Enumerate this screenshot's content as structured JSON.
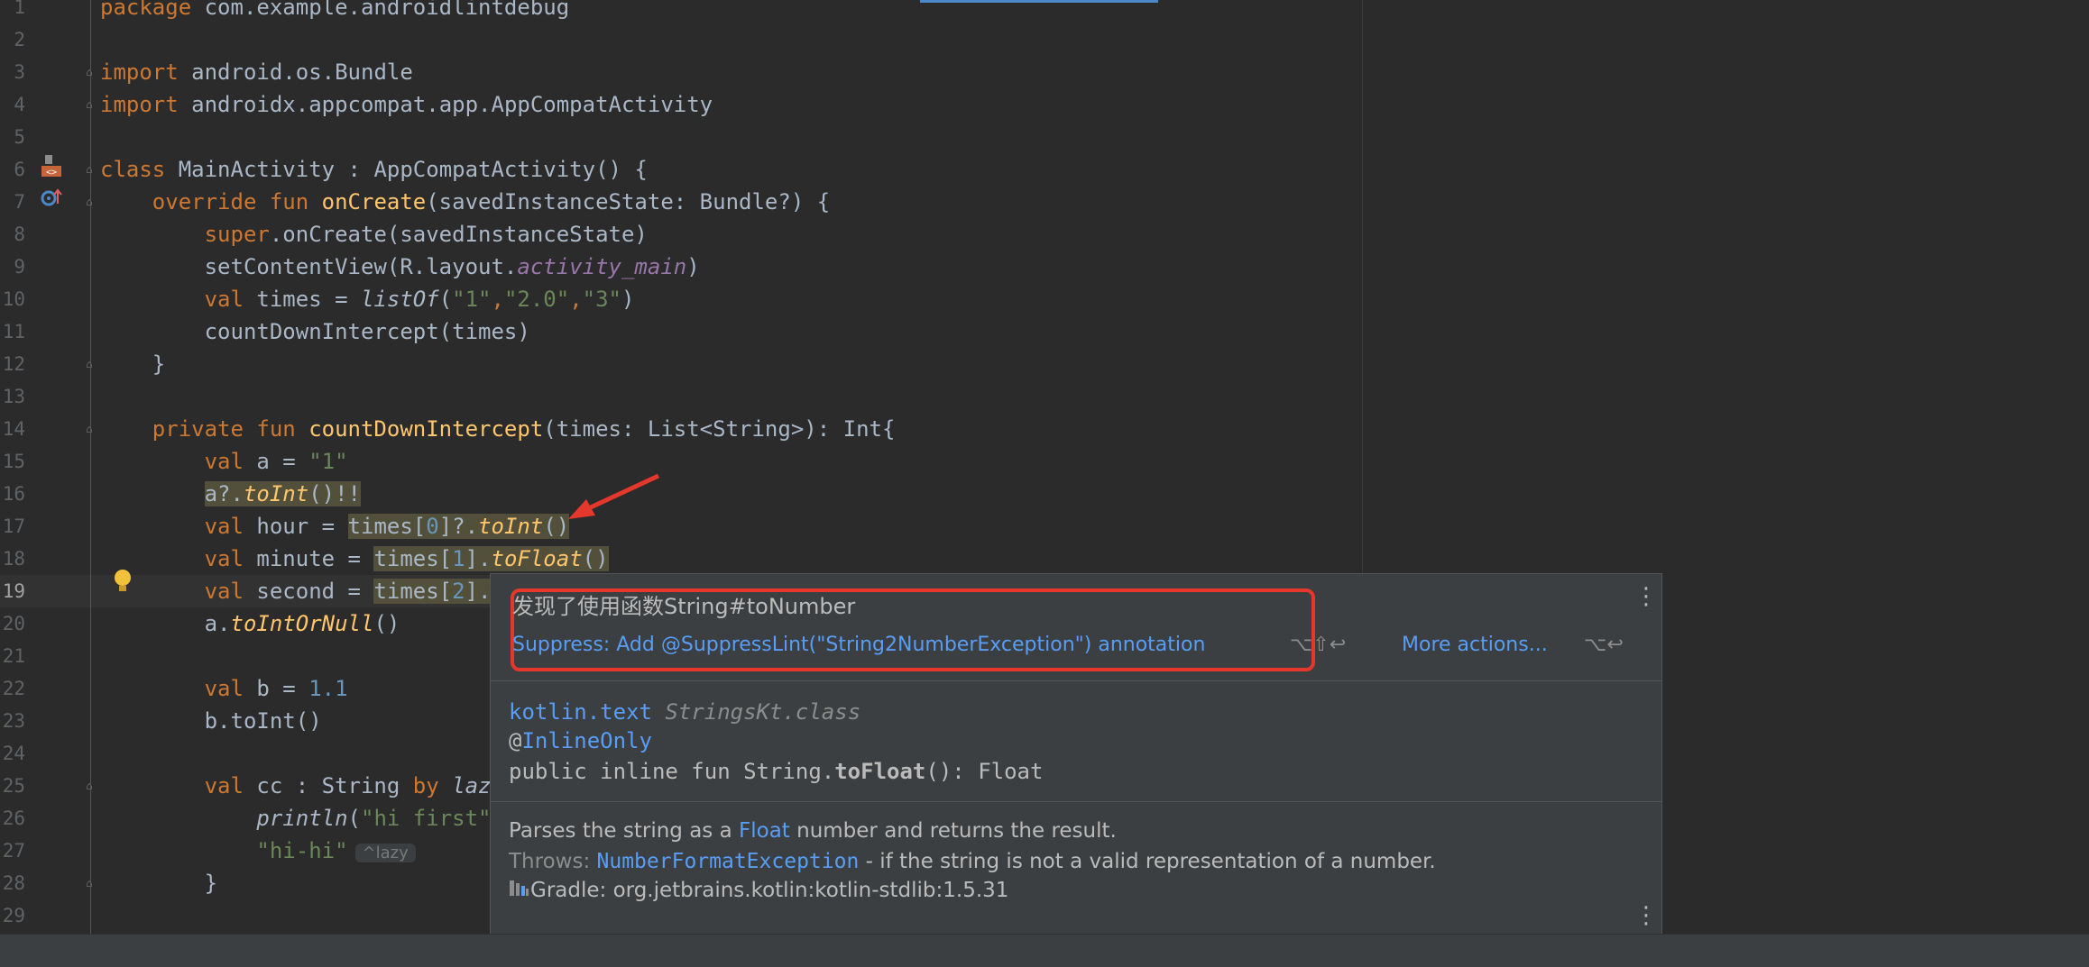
{
  "editor": {
    "lines": [
      {
        "n": "1",
        "segs": [
          {
            "t": "package ",
            "c": "kw"
          },
          {
            "t": "com.example.androidlintdebug",
            "c": ""
          }
        ]
      },
      {
        "n": "2",
        "segs": []
      },
      {
        "n": "3",
        "segs": [
          {
            "t": "import ",
            "c": "kw"
          },
          {
            "t": "android.os.Bundle",
            "c": ""
          }
        ]
      },
      {
        "n": "4",
        "segs": [
          {
            "t": "import ",
            "c": "kw"
          },
          {
            "t": "androidx.appcompat.app.AppCompatActivity",
            "c": ""
          }
        ]
      },
      {
        "n": "5",
        "segs": []
      },
      {
        "n": "6",
        "segs": [
          {
            "t": "class ",
            "c": "kw"
          },
          {
            "t": "MainActivity : AppCompatActivity() {",
            "c": ""
          }
        ]
      },
      {
        "n": "7",
        "segs": [
          {
            "t": "    override fun ",
            "c": "kw"
          },
          {
            "t": "onCreate",
            "c": "fn"
          },
          {
            "t": "(savedInstanceState: Bundle?) {",
            "c": ""
          }
        ]
      },
      {
        "n": "8",
        "segs": [
          {
            "t": "        super",
            "c": "kw"
          },
          {
            "t": ".onCreate(savedInstanceState)",
            "c": ""
          }
        ]
      },
      {
        "n": "9",
        "segs": [
          {
            "t": "        setContentView(R.layout.",
            "c": ""
          },
          {
            "t": "activity_main",
            "c": "prop"
          },
          {
            "t": ")",
            "c": ""
          }
        ]
      },
      {
        "n": "10",
        "segs": [
          {
            "t": "        val ",
            "c": "kw"
          },
          {
            "t": "times = ",
            "c": ""
          },
          {
            "t": "listOf",
            "c": "ital"
          },
          {
            "t": "(",
            "c": ""
          },
          {
            "t": "\"1\"",
            "c": "str"
          },
          {
            "t": ",",
            "c": "kw"
          },
          {
            "t": "\"2.0\"",
            "c": "str"
          },
          {
            "t": ",",
            "c": "kw"
          },
          {
            "t": "\"3\"",
            "c": "str"
          },
          {
            "t": ")",
            "c": ""
          }
        ]
      },
      {
        "n": "11",
        "segs": [
          {
            "t": "        countDownIntercept(times)",
            "c": ""
          }
        ]
      },
      {
        "n": "12",
        "segs": [
          {
            "t": "    }",
            "c": ""
          }
        ]
      },
      {
        "n": "13",
        "segs": []
      },
      {
        "n": "14",
        "segs": [
          {
            "t": "    private fun ",
            "c": "kw"
          },
          {
            "t": "countDownIntercept",
            "c": "fn"
          },
          {
            "t": "(times: List<String>): Int{",
            "c": ""
          }
        ]
      },
      {
        "n": "15",
        "segs": [
          {
            "t": "        val ",
            "c": "kw"
          },
          {
            "t": "a = ",
            "c": ""
          },
          {
            "t": "\"1\"",
            "c": "str"
          }
        ]
      },
      {
        "n": "16",
        "segs": [
          {
            "t": "        ",
            "c": ""
          },
          {
            "t": "a?.",
            "c": "warn"
          },
          {
            "t": "toInt",
            "c": "ext warn"
          },
          {
            "t": "()!!",
            "c": "warn"
          }
        ]
      },
      {
        "n": "17",
        "segs": [
          {
            "t": "        val ",
            "c": "kw"
          },
          {
            "t": "hour = ",
            "c": ""
          },
          {
            "t": "times[",
            "c": "warn"
          },
          {
            "t": "0",
            "c": "num warn"
          },
          {
            "t": "]?.",
            "c": "warn"
          },
          {
            "t": "toInt",
            "c": "ext warn"
          },
          {
            "t": "()",
            "c": "warn"
          }
        ]
      },
      {
        "n": "18",
        "segs": [
          {
            "t": "        val ",
            "c": "kw"
          },
          {
            "t": "minute = ",
            "c": ""
          },
          {
            "t": "times[",
            "c": "warn"
          },
          {
            "t": "1",
            "c": "num warn"
          },
          {
            "t": "].",
            "c": "warn"
          },
          {
            "t": "toFloat",
            "c": "ext warn"
          },
          {
            "t": "()",
            "c": "warn"
          }
        ]
      },
      {
        "n": "19",
        "segs": [
          {
            "t": "        val ",
            "c": "kw"
          },
          {
            "t": "second = ",
            "c": ""
          },
          {
            "t": "times[",
            "c": "warn"
          },
          {
            "t": "2",
            "c": "num warn"
          },
          {
            "t": "].",
            "c": "warn"
          },
          {
            "t": "t",
            "c": "ext warn"
          }
        ]
      },
      {
        "n": "20",
        "segs": [
          {
            "t": "        a.",
            "c": ""
          },
          {
            "t": "toIntOrNull",
            "c": "ext"
          },
          {
            "t": "()",
            "c": ""
          }
        ]
      },
      {
        "n": "21",
        "segs": []
      },
      {
        "n": "22",
        "segs": [
          {
            "t": "        val ",
            "c": "kw"
          },
          {
            "t": "b = ",
            "c": ""
          },
          {
            "t": "1.1",
            "c": "num"
          }
        ]
      },
      {
        "n": "23",
        "segs": [
          {
            "t": "        b.toInt()",
            "c": ""
          }
        ]
      },
      {
        "n": "24",
        "segs": []
      },
      {
        "n": "25",
        "segs": [
          {
            "t": "        val ",
            "c": "kw"
          },
          {
            "t": "cc : String ",
            "c": ""
          },
          {
            "t": "by ",
            "c": "kw"
          },
          {
            "t": "lazy",
            "c": "ital"
          }
        ]
      },
      {
        "n": "26",
        "segs": [
          {
            "t": "            ",
            "c": ""
          },
          {
            "t": "println",
            "c": "ital"
          },
          {
            "t": "(",
            "c": ""
          },
          {
            "t": "\"hi first\"",
            "c": "str"
          },
          {
            "t": ")",
            "c": ""
          }
        ]
      },
      {
        "n": "27",
        "segs": [
          {
            "t": "            ",
            "c": ""
          },
          {
            "t": "\"hi-hi\"",
            "c": "str"
          },
          {
            "t": "^lazy",
            "c": "hint"
          }
        ]
      },
      {
        "n": "28",
        "segs": [
          {
            "t": "        }",
            "c": ""
          }
        ]
      },
      {
        "n": "29",
        "segs": []
      }
    ]
  },
  "popup": {
    "title": "发现了使用函数String#toNumber",
    "suppress_label": "Suppress: Add @SuppressLint(\"String2NumberException\") annotation",
    "suppress_shortcut": "⌥⇧↩",
    "more_actions_label": "More actions...",
    "more_actions_shortcut": "⌥↩",
    "doc": {
      "package": "kotlin.text",
      "class_file": "StringsKt.class",
      "annotation_at": "@",
      "annotation_name": "InlineOnly",
      "signature_prefix": "public inline fun String.",
      "signature_name": "toFloat",
      "signature_suffix": "(): Float",
      "desc_prefix": "Parses the string as a ",
      "desc_link": "Float",
      "desc_suffix": " number and returns the result.",
      "throws_label": "Throws: ",
      "throws_link": "NumberFormatException",
      "throws_suffix": " - if the string is not a valid representation of a number.",
      "gradle": "Gradle: org.jetbrains.kotlin:kotlin-stdlib:1.5.31"
    }
  },
  "icons": {
    "arrow_color": "#e5382d",
    "bulb": "lightbulb-icon",
    "kebab": "more-vert-icon",
    "library": "library-icon"
  }
}
